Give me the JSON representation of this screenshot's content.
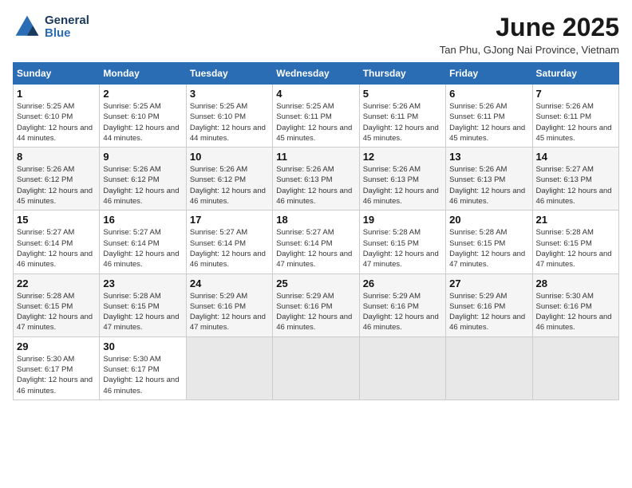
{
  "logo": {
    "line1": "General",
    "line2": "Blue"
  },
  "title": "June 2025",
  "location": "Tan Phu, GJong Nai Province, Vietnam",
  "weekdays": [
    "Sunday",
    "Monday",
    "Tuesday",
    "Wednesday",
    "Thursday",
    "Friday",
    "Saturday"
  ],
  "weeks": [
    [
      {
        "day": "1",
        "sunrise": "5:25 AM",
        "sunset": "6:10 PM",
        "daylight": "12 hours and 44 minutes."
      },
      {
        "day": "2",
        "sunrise": "5:25 AM",
        "sunset": "6:10 PM",
        "daylight": "12 hours and 44 minutes."
      },
      {
        "day": "3",
        "sunrise": "5:25 AM",
        "sunset": "6:10 PM",
        "daylight": "12 hours and 44 minutes."
      },
      {
        "day": "4",
        "sunrise": "5:25 AM",
        "sunset": "6:11 PM",
        "daylight": "12 hours and 45 minutes."
      },
      {
        "day": "5",
        "sunrise": "5:26 AM",
        "sunset": "6:11 PM",
        "daylight": "12 hours and 45 minutes."
      },
      {
        "day": "6",
        "sunrise": "5:26 AM",
        "sunset": "6:11 PM",
        "daylight": "12 hours and 45 minutes."
      },
      {
        "day": "7",
        "sunrise": "5:26 AM",
        "sunset": "6:11 PM",
        "daylight": "12 hours and 45 minutes."
      }
    ],
    [
      {
        "day": "8",
        "sunrise": "5:26 AM",
        "sunset": "6:12 PM",
        "daylight": "12 hours and 45 minutes."
      },
      {
        "day": "9",
        "sunrise": "5:26 AM",
        "sunset": "6:12 PM",
        "daylight": "12 hours and 46 minutes."
      },
      {
        "day": "10",
        "sunrise": "5:26 AM",
        "sunset": "6:12 PM",
        "daylight": "12 hours and 46 minutes."
      },
      {
        "day": "11",
        "sunrise": "5:26 AM",
        "sunset": "6:13 PM",
        "daylight": "12 hours and 46 minutes."
      },
      {
        "day": "12",
        "sunrise": "5:26 AM",
        "sunset": "6:13 PM",
        "daylight": "12 hours and 46 minutes."
      },
      {
        "day": "13",
        "sunrise": "5:26 AM",
        "sunset": "6:13 PM",
        "daylight": "12 hours and 46 minutes."
      },
      {
        "day": "14",
        "sunrise": "5:27 AM",
        "sunset": "6:13 PM",
        "daylight": "12 hours and 46 minutes."
      }
    ],
    [
      {
        "day": "15",
        "sunrise": "5:27 AM",
        "sunset": "6:14 PM",
        "daylight": "12 hours and 46 minutes."
      },
      {
        "day": "16",
        "sunrise": "5:27 AM",
        "sunset": "6:14 PM",
        "daylight": "12 hours and 46 minutes."
      },
      {
        "day": "17",
        "sunrise": "5:27 AM",
        "sunset": "6:14 PM",
        "daylight": "12 hours and 46 minutes."
      },
      {
        "day": "18",
        "sunrise": "5:27 AM",
        "sunset": "6:14 PM",
        "daylight": "12 hours and 47 minutes."
      },
      {
        "day": "19",
        "sunrise": "5:28 AM",
        "sunset": "6:15 PM",
        "daylight": "12 hours and 47 minutes."
      },
      {
        "day": "20",
        "sunrise": "5:28 AM",
        "sunset": "6:15 PM",
        "daylight": "12 hours and 47 minutes."
      },
      {
        "day": "21",
        "sunrise": "5:28 AM",
        "sunset": "6:15 PM",
        "daylight": "12 hours and 47 minutes."
      }
    ],
    [
      {
        "day": "22",
        "sunrise": "5:28 AM",
        "sunset": "6:15 PM",
        "daylight": "12 hours and 47 minutes."
      },
      {
        "day": "23",
        "sunrise": "5:28 AM",
        "sunset": "6:15 PM",
        "daylight": "12 hours and 47 minutes."
      },
      {
        "day": "24",
        "sunrise": "5:29 AM",
        "sunset": "6:16 PM",
        "daylight": "12 hours and 47 minutes."
      },
      {
        "day": "25",
        "sunrise": "5:29 AM",
        "sunset": "6:16 PM",
        "daylight": "12 hours and 46 minutes."
      },
      {
        "day": "26",
        "sunrise": "5:29 AM",
        "sunset": "6:16 PM",
        "daylight": "12 hours and 46 minutes."
      },
      {
        "day": "27",
        "sunrise": "5:29 AM",
        "sunset": "6:16 PM",
        "daylight": "12 hours and 46 minutes."
      },
      {
        "day": "28",
        "sunrise": "5:30 AM",
        "sunset": "6:16 PM",
        "daylight": "12 hours and 46 minutes."
      }
    ],
    [
      {
        "day": "29",
        "sunrise": "5:30 AM",
        "sunset": "6:17 PM",
        "daylight": "12 hours and 46 minutes."
      },
      {
        "day": "30",
        "sunrise": "5:30 AM",
        "sunset": "6:17 PM",
        "daylight": "12 hours and 46 minutes."
      },
      null,
      null,
      null,
      null,
      null
    ]
  ],
  "labels": {
    "sunrise": "Sunrise:",
    "sunset": "Sunset:",
    "daylight": "Daylight:"
  }
}
